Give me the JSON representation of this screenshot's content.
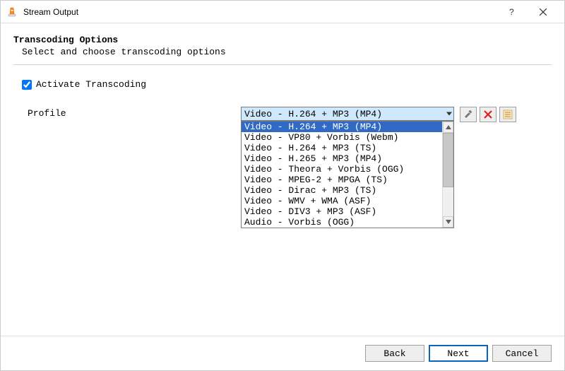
{
  "window": {
    "title": "Stream Output"
  },
  "header": {
    "title": "Transcoding Options",
    "subtitle": "Select and choose transcoding options"
  },
  "transcoding": {
    "checkbox_label": "Activate Transcoding",
    "checked": true
  },
  "profile": {
    "label": "Profile",
    "selected": "Video - H.264 + MP3 (MP4)",
    "options": [
      "Video - H.264 + MP3 (MP4)",
      "Video - VP80 + Vorbis (Webm)",
      "Video - H.264 + MP3 (TS)",
      "Video - H.265 + MP3 (MP4)",
      "Video - Theora + Vorbis (OGG)",
      "Video - MPEG-2 + MPGA (TS)",
      "Video - Dirac + MP3 (TS)",
      "Video - WMV + WMA (ASF)",
      "Video - DIV3 + MP3 (ASF)",
      "Audio - Vorbis (OGG)"
    ]
  },
  "buttons": {
    "back": "Back",
    "next": "Next",
    "cancel": "Cancel"
  }
}
